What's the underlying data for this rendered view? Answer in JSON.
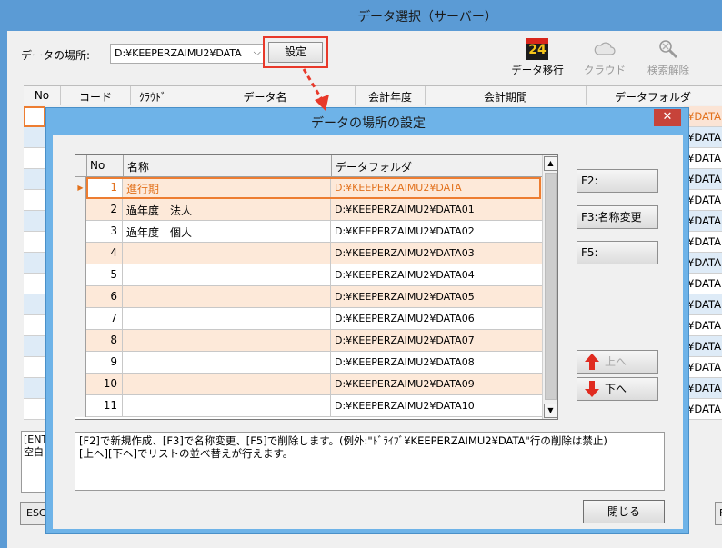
{
  "main_window": {
    "title": "データ選択（サーバー）",
    "location_label": "データの場所:",
    "location_value": "D:¥KEEPERZAIMU2¥DATA",
    "settings_button": "設定",
    "toolbar": {
      "migrate": {
        "label": "データ移行",
        "icon": "keeper24-logo-icon"
      },
      "cloud": {
        "label": "クラウド",
        "icon": "cloud-icon"
      },
      "search_clear": {
        "label": "検索解除",
        "icon": "search-clear-icon"
      }
    },
    "table_headers": [
      "No",
      "コード",
      "ｸﾗｳﾄﾞ",
      "データ名",
      "会計年度",
      "会計期間",
      "データフォルダ"
    ],
    "right_column_cell": "¥DATA",
    "note_lines": [
      "[ENT",
      "空白"
    ],
    "esc_button": "ESC",
    "right_partial_button": "F"
  },
  "dialog": {
    "title": "データの場所の設定",
    "close_glyph": "✕",
    "grid_headers": {
      "no": "No",
      "name": "名称",
      "folder": "データフォルダ"
    },
    "rows": [
      {
        "no": "1",
        "name": "進行期",
        "folder": "D:¥KEEPERZAIMU2¥DATA"
      },
      {
        "no": "2",
        "name": "過年度　法人",
        "folder": "D:¥KEEPERZAIMU2¥DATA01"
      },
      {
        "no": "3",
        "name": "過年度　個人",
        "folder": "D:¥KEEPERZAIMU2¥DATA02"
      },
      {
        "no": "4",
        "name": "",
        "folder": "D:¥KEEPERZAIMU2¥DATA03"
      },
      {
        "no": "5",
        "name": "",
        "folder": "D:¥KEEPERZAIMU2¥DATA04"
      },
      {
        "no": "6",
        "name": "",
        "folder": "D:¥KEEPERZAIMU2¥DATA05"
      },
      {
        "no": "7",
        "name": "",
        "folder": "D:¥KEEPERZAIMU2¥DATA06"
      },
      {
        "no": "8",
        "name": "",
        "folder": "D:¥KEEPERZAIMU2¥DATA07"
      },
      {
        "no": "9",
        "name": "",
        "folder": "D:¥KEEPERZAIMU2¥DATA08"
      },
      {
        "no": "10",
        "name": "",
        "folder": "D:¥KEEPERZAIMU2¥DATA09"
      },
      {
        "no": "11",
        "name": "",
        "folder": "D:¥KEEPERZAIMU2¥DATA10"
      }
    ],
    "selected_row": 0,
    "buttons": {
      "f2": "F2:",
      "f3": "F3:名称変更",
      "f5": "F5:",
      "up": "上へ",
      "down": "下へ",
      "close": "閉じる"
    },
    "help_lines": [
      "[F2]で新規作成、[F3]で名称変更、[F5]で削除します。(例外:\"ﾄﾞﾗｲﾌﾞ¥KEEPERZAIMU2¥DATA\"行の削除は禁止)",
      "[上へ][下へ]でリストの並べ替えが行えます。"
    ]
  },
  "colors": {
    "title_bar": "#5b9bd5",
    "dialog_frame": "#6eb3e8",
    "selected_text": "#e2711c",
    "alt_row": "#fde9d9",
    "annotation_red": "#e8392a",
    "close_red": "#c7433a"
  }
}
